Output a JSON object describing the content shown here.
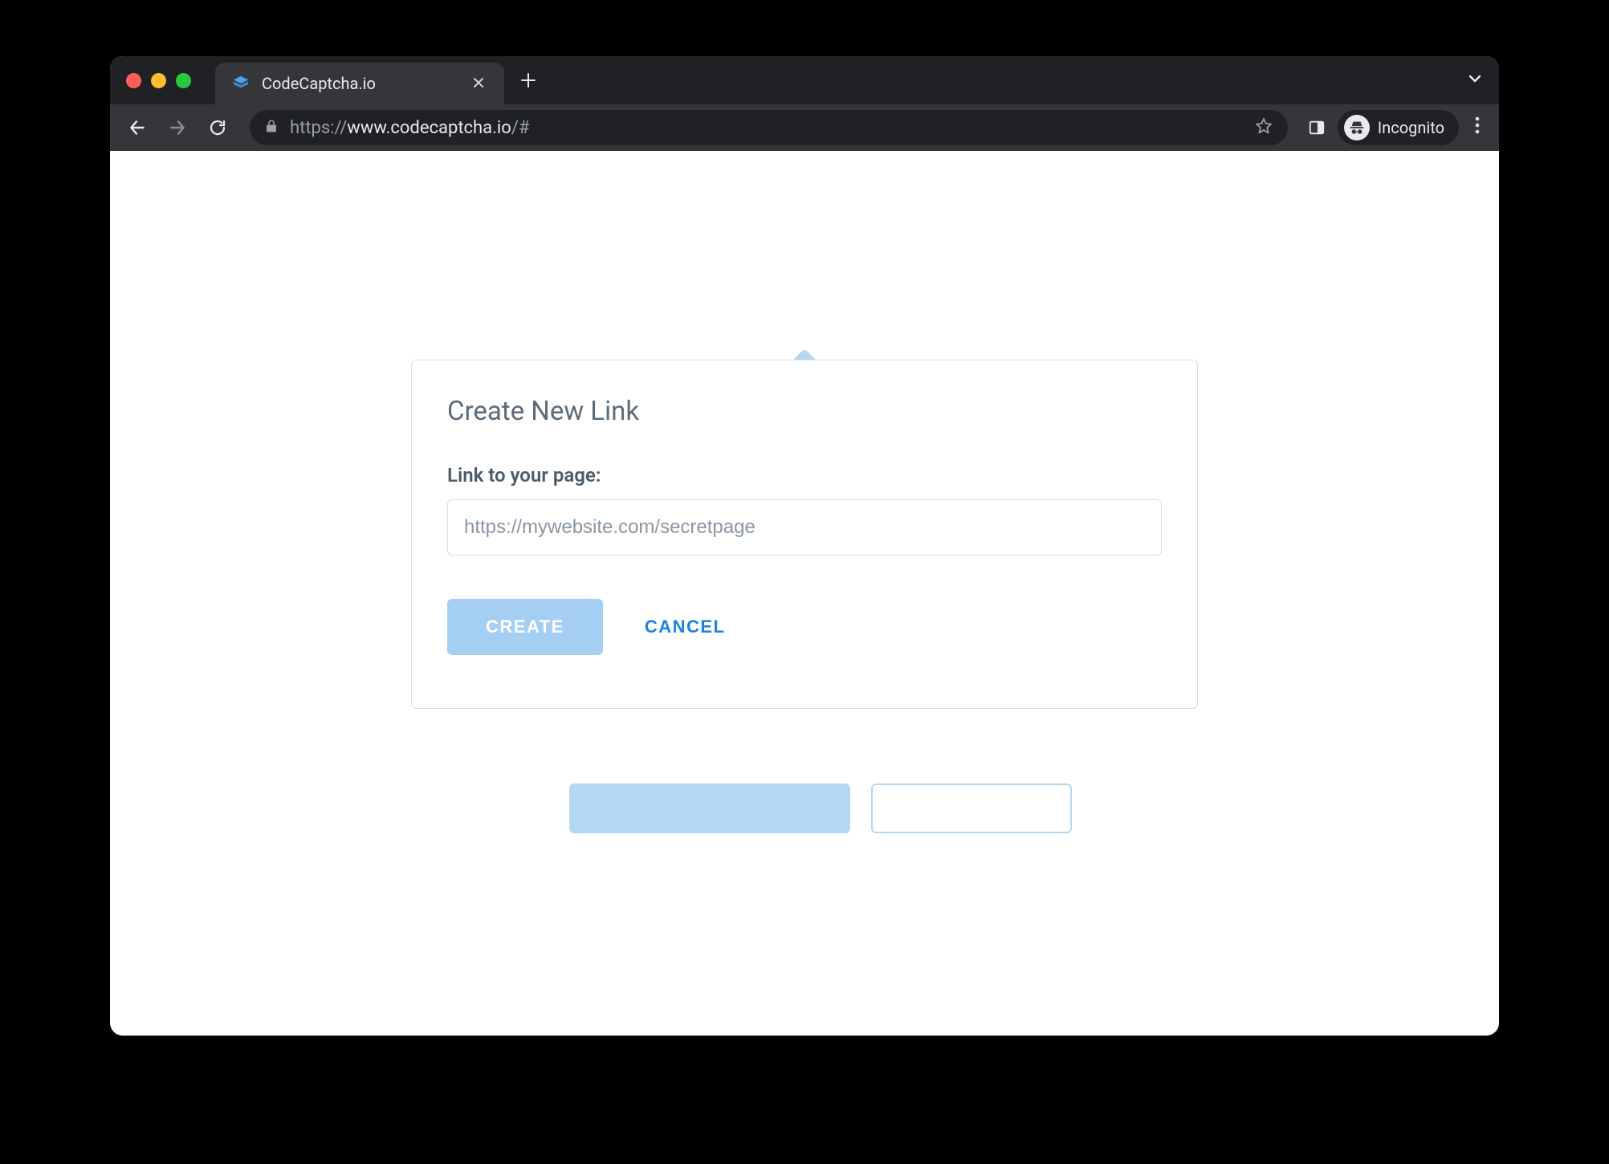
{
  "browser": {
    "tab_title": "CodeCaptcha.io",
    "url_prefix": "https://",
    "url_domain": "www.codecaptcha.io",
    "url_suffix": "/#",
    "incognito_label": "Incognito"
  },
  "modal": {
    "title": "Create New Link",
    "field_label": "Link to your page:",
    "input_placeholder": "https://mywebsite.com/secretpage",
    "create_label": "CREATE",
    "cancel_label": "CANCEL"
  }
}
